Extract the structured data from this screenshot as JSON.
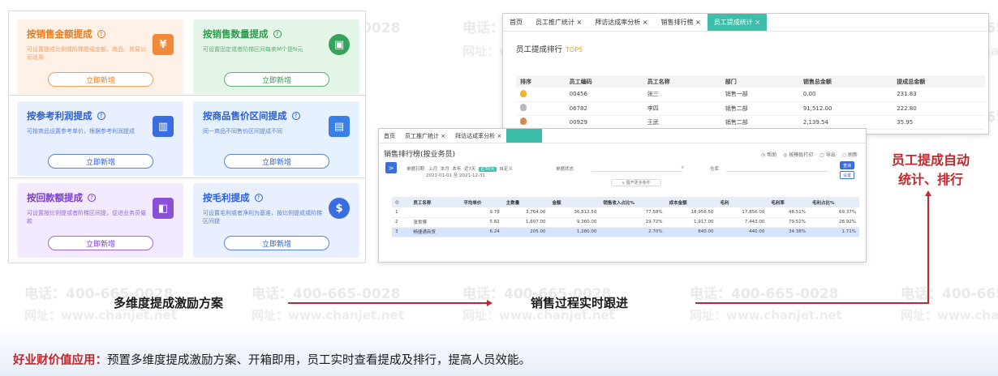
{
  "watermarks": {
    "phone": "电话：400-665-0028",
    "site": "网址：www.chanjet.net"
  },
  "left_panel": {
    "cards": [
      {
        "title": "按销售金额提成",
        "desc": "可设置提成比例或阶梯提成金额，商品、贸易公司适用",
        "button": "立即新增",
        "icon": "document-icon"
      },
      {
        "title": "按销售数量提成",
        "desc": "可设置固定或者阶梯区间每卖M个提N元",
        "button": "立即新增",
        "icon": "box-icon"
      },
      {
        "title": "按参考利润提成",
        "desc": "可按商品设置参考单价，根据参考利润提成",
        "button": "立即新增",
        "icon": "chart-icon"
      },
      {
        "title": "按商品售价区间提成",
        "desc": "同一商品不同售价区间提成不同",
        "button": "立即新增",
        "icon": "bag-icon"
      },
      {
        "title": "按回款额提成",
        "desc": "可设置按比例提或者阶梯区间提，促进业务员催款",
        "button": "立即新增",
        "icon": "wallet-icon"
      },
      {
        "title": "按毛利提成",
        "desc": "可设置毛利或者净利为基准，按比例提成或阶梯区间提",
        "button": "立即新增",
        "icon": "moneybag-icon"
      }
    ],
    "help_glyph": "?"
  },
  "win_top": {
    "tabs": [
      "首页",
      "员工推广统计 ×",
      "拜访达成率分析 ×",
      "销售排行榜 ×",
      "员工提成统计 ×"
    ],
    "title": "员工提成排行",
    "top_tag": "TOP5",
    "columns": [
      "排序",
      "员工编码",
      "员工名称",
      "部门",
      "销售总金额",
      "提成总金额"
    ],
    "rows": [
      {
        "code": "00456",
        "name": "张三",
        "dept": "销售一部",
        "sales": "0.00",
        "commission": "231.83"
      },
      {
        "code": "06782",
        "name": "李四",
        "dept": "销售二部",
        "sales": "91,512.00",
        "commission": "222.80"
      },
      {
        "code": "00929",
        "name": "王武",
        "dept": "销售二部",
        "sales": "2,139.54",
        "commission": "35.95"
      }
    ]
  },
  "win_bottom": {
    "tabs": [
      "首页",
      "员工推广统计 ×",
      "拜访达成率分析 ×",
      ""
    ],
    "title": "销售排行榜(按业务员)",
    "actions": [
      "◷ 帮助",
      "◎ 按模板打印",
      "▢ 导出",
      "○ 刷新"
    ],
    "filter_label": "单据日期",
    "filter_opts": [
      "上月",
      "本月",
      "本年",
      "近7天"
    ],
    "filter_selected": "近30天",
    "filter_custom": "自定义",
    "date_range": "2021-01-01 至 2021-12-31",
    "status_label": "单据状态",
    "warehouse_label": "仓库",
    "query_btn": "查询",
    "reset_btn": "设置",
    "more_btn": "∨ 展开更多条件",
    "columns": [
      "◎",
      "员工名称",
      "平均单价",
      "主数量",
      "金额",
      "销售收入占比%",
      "成本金额",
      "毛利",
      "毛利率",
      "毛利占比%"
    ],
    "rows": [
      {
        "idx": "1",
        "name": "",
        "avg": "9.78",
        "qty": "3,764.00",
        "amount": "36,812.50",
        "share": "77.58%",
        "cost": "18,956.50",
        "profit": "17,856.00",
        "rate": "48.51%",
        "pshare": "69.37%"
      },
      {
        "idx": "2",
        "name": "张世博",
        "avg": "5.82",
        "qty": "1,607.00",
        "amount": "9,360.00",
        "share": "19.72%",
        "cost": "1,917.00",
        "profit": "7,443.00",
        "rate": "79.52%",
        "pshare": "28.92%"
      },
      {
        "idx": "3",
        "name": "畅捷通商贸",
        "avg": "6.24",
        "qty": "205.00",
        "amount": "1,280.00",
        "share": "2.70%",
        "cost": "840.00",
        "profit": "440.00",
        "rate": "34.38%",
        "pshare": "1.71%"
      }
    ]
  },
  "flow": {
    "step1": "多维度提成激励方案",
    "step2": "销售过程实时跟进",
    "step3_line1": "员工提成自动",
    "step3_line2": "统计、排行"
  },
  "footer": {
    "lead": "好业财价值应用：",
    "text": "预置多维度提成激励方案、开箱即用，员工实时查看提成及排行，提高人员效能。"
  },
  "colors": {
    "accent_red": "#c0282d",
    "tab_active": "#3bbfaa",
    "primary_blue": "#3a6ee0"
  }
}
